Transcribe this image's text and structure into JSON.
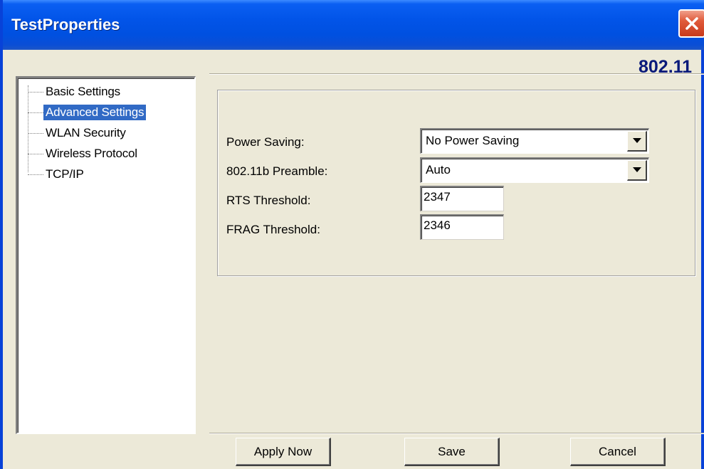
{
  "window": {
    "title": "TestProperties",
    "brand": "802.11",
    "accent_color": "#0842d8",
    "selection_color": "#316ac5"
  },
  "tree": {
    "items": [
      {
        "label": "Basic Settings",
        "selected": false
      },
      {
        "label": "Advanced Settings",
        "selected": true
      },
      {
        "label": "WLAN Security",
        "selected": false
      },
      {
        "label": "Wireless Protocol",
        "selected": false
      },
      {
        "label": "TCP/IP",
        "selected": false
      }
    ]
  },
  "settings": {
    "power_saving": {
      "label": "Power Saving:",
      "value": "No Power Saving"
    },
    "preamble": {
      "label": "802.11b Preamble:",
      "value": "Auto"
    },
    "rts_threshold": {
      "label": "RTS Threshold:",
      "value": "2347"
    },
    "frag_threshold": {
      "label": "FRAG Threshold:",
      "value": "2346"
    }
  },
  "buttons": {
    "apply_now": "Apply Now",
    "save": "Save",
    "cancel": "Cancel"
  },
  "icons": {
    "close": "close-icon",
    "dropdown": "chevron-down-icon"
  }
}
